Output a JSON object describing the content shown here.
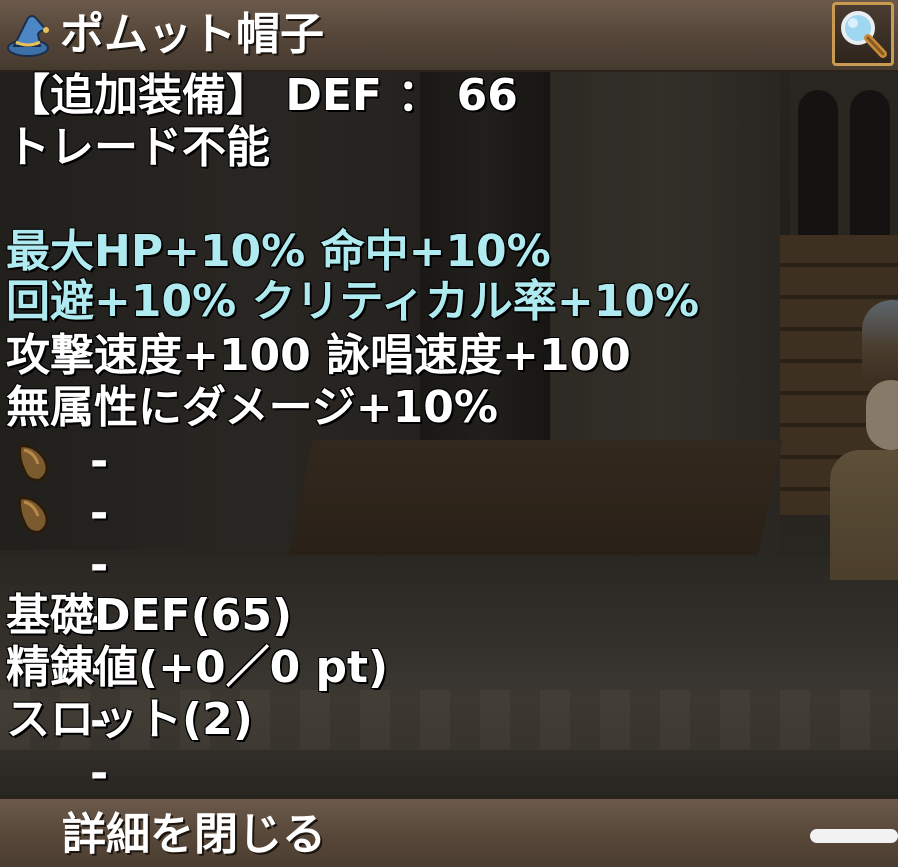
{
  "header": {
    "item_name": "ポムット帽子",
    "item_icon": "wizard-hat-icon",
    "zoom_icon": "magnifier-icon"
  },
  "stats": {
    "equip_line": "【追加装備】 DEF ： 66",
    "trade": "トレード不能",
    "bonus_lines": [
      "最大HP+10% 命中+10%",
      "回避+10% クリティカル率+10%"
    ],
    "speed_line": "攻撃速度+100 詠唱速度+100",
    "damage_line": "無属性にダメージ+10%"
  },
  "card_slots": [
    {
      "icon": "card-slot-icon",
      "label": "------"
    },
    {
      "icon": "card-slot-icon",
      "label": "------"
    }
  ],
  "details": {
    "base_def": "基礎DEF(65)",
    "refine": "精錬値(+0／0 pt)",
    "slots": "スロット(2)"
  },
  "footer": {
    "close_label": "詳細を閉じる"
  },
  "colors": {
    "bonus_text": "#aeeaf0",
    "normal_text": "#ffffff",
    "bar_brown": "#544538",
    "button_border": "#c99a52"
  }
}
